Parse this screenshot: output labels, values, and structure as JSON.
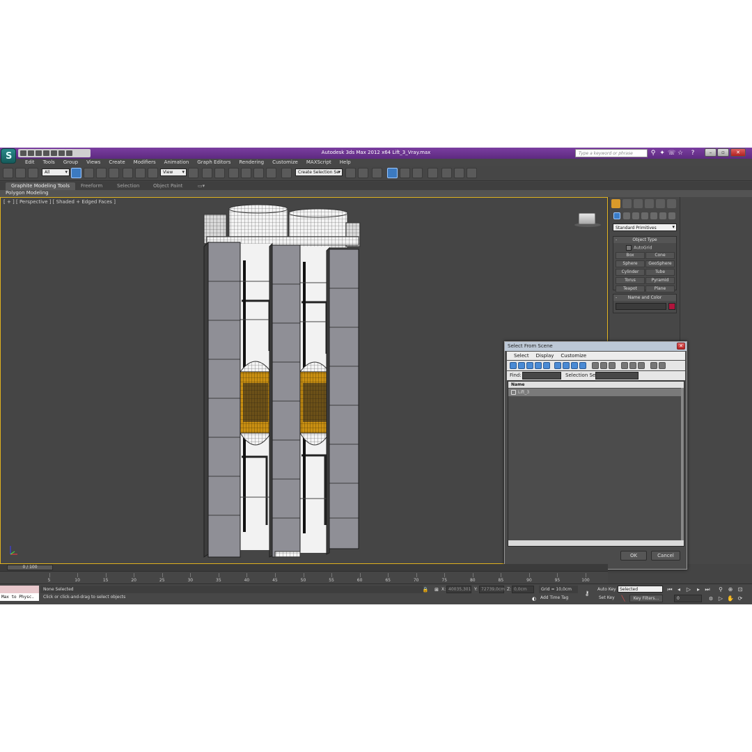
{
  "window": {
    "title": "Autodesk 3ds Max  2012 x64     Lift_3_Vray.max",
    "search_placeholder": "Type a keyword or phrase"
  },
  "menu": [
    "Edit",
    "Tools",
    "Group",
    "Views",
    "Create",
    "Modifiers",
    "Animation",
    "Graph Editors",
    "Rendering",
    "Customize",
    "MAXScript",
    "Help"
  ],
  "toolbar": {
    "selection_filter": "All",
    "ref_coord": "View",
    "named_selection": "Create Selection Se"
  },
  "ribbon": {
    "tabs": [
      "Graphite Modeling Tools",
      "Freeform",
      "Selection",
      "Object Paint"
    ],
    "panel_label": "Polygon Modeling"
  },
  "viewport": {
    "label": "[ + ] [ Perspective ] [ Shaded + Edged Faces ]"
  },
  "command_panel": {
    "category": "Standard Primitives",
    "object_type_title": "Object Type",
    "autogrid_label": "AutoGrid",
    "buttons": [
      "Box",
      "Cone",
      "Sphere",
      "GeoSphere",
      "Cylinder",
      "Tube",
      "Torus",
      "Pyramid",
      "Teapot",
      "Plane"
    ],
    "name_color_title": "Name and Color",
    "color": "#b0143c"
  },
  "dialog": {
    "title": "Select From Scene",
    "menu": [
      "Select",
      "Display",
      "Customize"
    ],
    "find_label": "Find:",
    "selection_set_label": "Selection Set:",
    "column_name": "Name",
    "items": [
      "Lift_3"
    ],
    "ok_label": "OK",
    "cancel_label": "Cancel"
  },
  "timeline": {
    "position_label": "0 / 100",
    "ticks": [
      "5",
      "10",
      "15",
      "20",
      "25",
      "30",
      "35",
      "40",
      "45",
      "50",
      "55",
      "60",
      "65",
      "70",
      "75",
      "80",
      "85",
      "90",
      "95",
      "100"
    ]
  },
  "status": {
    "maxscript_text": "Max to Physc.",
    "selection_text": "None Selected",
    "prompt_text": "Click or click-and-drag to select objects",
    "x_label": "X:",
    "x_value": "40035,301",
    "y_label": "Y:",
    "y_value": "72739,0cm",
    "z_label": "Z:",
    "z_value": "0,0cm",
    "grid_text": "Grid = 10,0cm",
    "add_time_tag": "Add Time Tag",
    "auto_key": "Auto Key",
    "set_key": "Set Key",
    "key_mode": "Selected",
    "key_filters": "Key Filters...",
    "frame_value": "0"
  }
}
